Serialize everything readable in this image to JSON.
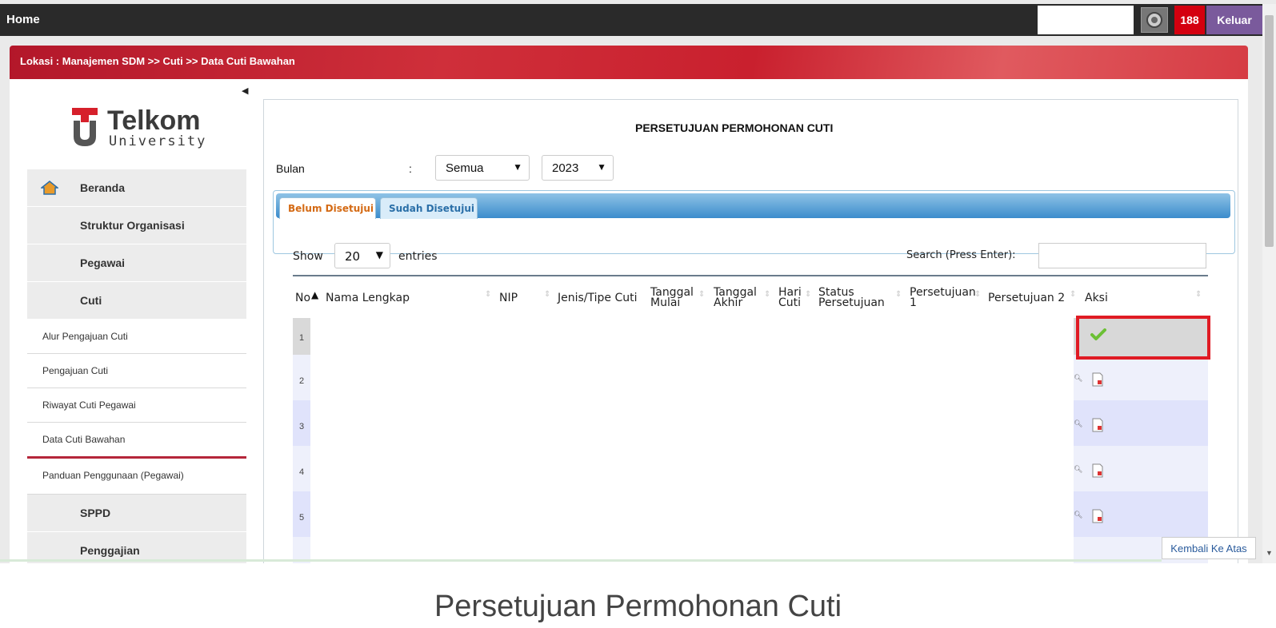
{
  "topbar": {
    "home": "Home",
    "notif_count": "188",
    "logout": "Keluar"
  },
  "breadcrumb": "Lokasi : Manajemen SDM >> Cuti >> Data Cuti Bawahan",
  "logo": {
    "line1": "Telkom",
    "line2": "University"
  },
  "sidebar": {
    "main": [
      "Beranda",
      "Struktur Organisasi",
      "Pegawai",
      "Cuti"
    ],
    "sub": [
      "Alur Pengajuan Cuti",
      "Pengajuan Cuti",
      "Riwayat Cuti Pegawai",
      "Data Cuti Bawahan",
      "Panduan Penggunaan (Pegawai)"
    ],
    "more": [
      "SPPD",
      "Penggajian"
    ]
  },
  "page": {
    "title": "PERSETUJUAN PERMOHONAN CUTI",
    "filter_label": "Bulan",
    "filter_colon": ":",
    "month": "Semua",
    "year": "2023"
  },
  "tabs": {
    "pending": "Belum Disetujui",
    "approved": "Sudah Disetujui"
  },
  "table": {
    "show": "Show",
    "page_size": "20",
    "entries": "entries",
    "search_label": "Search (Press Enter):",
    "headers": {
      "no": "No",
      "nama": "Nama Lengkap",
      "nip": "NIP",
      "jenis": "Jenis/Tipe Cuti",
      "tgl_mulai_1": "Tanggal",
      "tgl_mulai_2": "Mulai",
      "tgl_akhir_1": "Tanggal",
      "tgl_akhir_2": "Akhir",
      "hari_1": "Hari",
      "hari_2": "Cuti",
      "status_1": "Status",
      "status_2": "Persetujuan",
      "pers1_1": "Persetujuan",
      "pers1_2": "1",
      "pers2": "Persetujuan 2",
      "aksi": "Aksi"
    },
    "rows": [
      "1",
      "2",
      "3",
      "4",
      "5"
    ]
  },
  "back_to_top": "Kembali Ke Atas",
  "caption": "Persetujuan Permohonan Cuti",
  "colors": {
    "topbar": "#2a2a2a",
    "badge": "#d4000f",
    "logout": "#7a5a9c",
    "brand_red": "#c9202e",
    "tab_blue": "#3b8ccc",
    "highlight": "#e01b24"
  }
}
